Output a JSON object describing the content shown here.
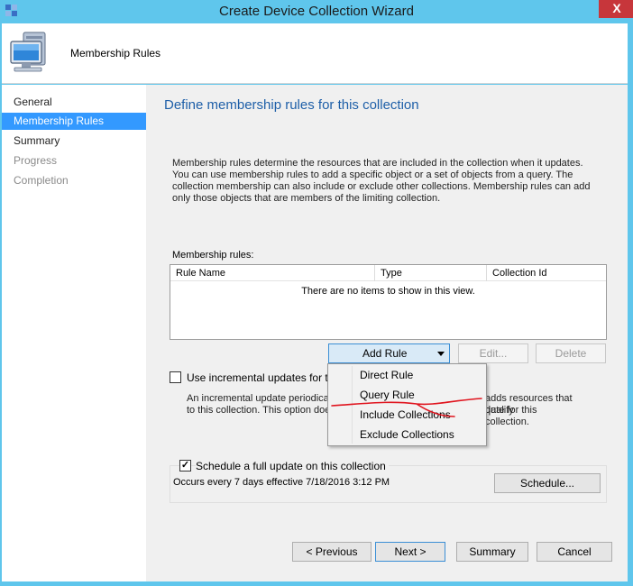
{
  "window": {
    "title": "Create Device Collection Wizard",
    "close_glyph": "X"
  },
  "header": {
    "title": "Membership Rules",
    "icon": "computer-icon"
  },
  "nav": {
    "items": [
      {
        "label": "General",
        "state": "normal"
      },
      {
        "label": "Membership Rules",
        "state": "selected"
      },
      {
        "label": "Summary",
        "state": "normal"
      },
      {
        "label": "Progress",
        "state": "disabled"
      },
      {
        "label": "Completion",
        "state": "disabled"
      }
    ]
  },
  "main": {
    "title": "Define membership rules for this collection",
    "description": "Membership rules determine the resources that are included in the collection when it updates. You can use membership rules to add a specific object or a set of objects from a query. The collection membership can also include or exclude other collections. Membership rules can add only those objects that are members of the limiting collection.",
    "rules_label": "Membership rules:",
    "columns": [
      "Rule Name",
      "Type",
      "Collection Id"
    ],
    "empty_text": "There are no items to show in this view.",
    "add_rule_label": "Add Rule",
    "edit_label": "Edit...",
    "delete_label": "Delete",
    "incremental_label": "Use incremental updates for this c",
    "incremental_checked": false,
    "incremental_desc_line1": "An incremental update periodicall",
    "incremental_desc_line1_tail": "adds resources that qualify",
    "incremental_desc_line2": "to this collection. This option doe",
    "incremental_desc_line2_tail": "date for this collection.",
    "schedule_label": "Schedule a full update on this collection",
    "schedule_checked": true,
    "schedule_text": "Occurs every 7 days effective 7/18/2016 3:12 PM",
    "schedule_button": "Schedule..."
  },
  "add_rule_menu": {
    "items": [
      "Direct Rule",
      "Query Rule",
      "Include Collections",
      "Exclude Collections"
    ]
  },
  "footer": {
    "previous": "< Previous",
    "next": "Next >",
    "summary": "Summary",
    "cancel": "Cancel"
  },
  "colors": {
    "frame": "#5fc6ec",
    "selection": "#3399ff",
    "title_blue": "#1e5fa8",
    "annotation_red": "#e0141e"
  }
}
